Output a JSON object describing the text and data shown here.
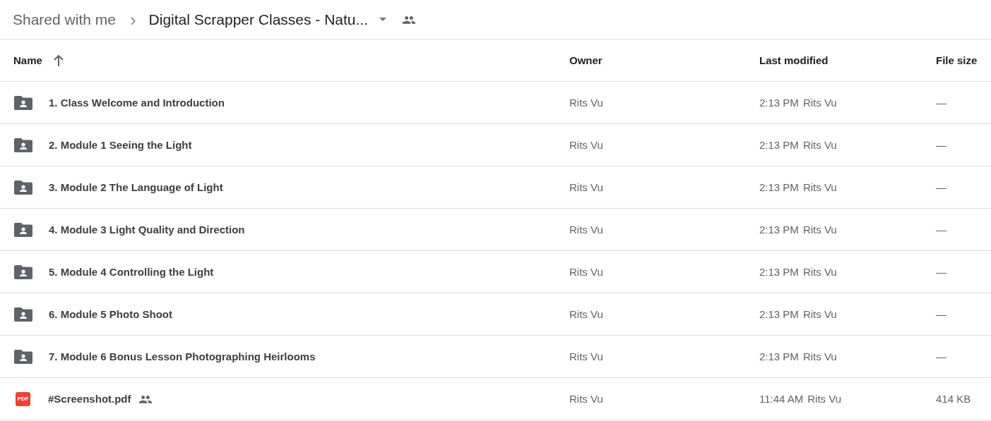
{
  "breadcrumb": {
    "parent": "Shared with me",
    "separator": "›",
    "current": "Digital Scrapper Classes - Natu..."
  },
  "table": {
    "columns": [
      {
        "label": "Name",
        "sorted": true
      },
      {
        "label": "Owner",
        "sorted": false
      },
      {
        "label": "Last modified",
        "sorted": false
      },
      {
        "label": "File size",
        "sorted": false
      }
    ],
    "rows": [
      {
        "kind": "folder",
        "name": "1. Class Welcome and Introduction",
        "shared": false,
        "owner": "Rits Vu",
        "modified_time": "2:13 PM",
        "modified_by": "Rits Vu",
        "size": "—"
      },
      {
        "kind": "folder",
        "name": "2. Module 1 Seeing the Light",
        "shared": false,
        "owner": "Rits Vu",
        "modified_time": "2:13 PM",
        "modified_by": "Rits Vu",
        "size": "—"
      },
      {
        "kind": "folder",
        "name": "3. Module 2 The Language of Light",
        "shared": false,
        "owner": "Rits Vu",
        "modified_time": "2:13 PM",
        "modified_by": "Rits Vu",
        "size": "—"
      },
      {
        "kind": "folder",
        "name": "4. Module 3 Light Quality and Direction",
        "shared": false,
        "owner": "Rits Vu",
        "modified_time": "2:13 PM",
        "modified_by": "Rits Vu",
        "size": "—"
      },
      {
        "kind": "folder",
        "name": "5. Module 4 Controlling the Light",
        "shared": false,
        "owner": "Rits Vu",
        "modified_time": "2:13 PM",
        "modified_by": "Rits Vu",
        "size": "—"
      },
      {
        "kind": "folder",
        "name": "6. Module 5 Photo Shoot",
        "shared": false,
        "owner": "Rits Vu",
        "modified_time": "2:13 PM",
        "modified_by": "Rits Vu",
        "size": "—"
      },
      {
        "kind": "folder",
        "name": "7. Module 6 Bonus Lesson Photographing Heirlooms",
        "shared": false,
        "owner": "Rits Vu",
        "modified_time": "2:13 PM",
        "modified_by": "Rits Vu",
        "size": "—"
      },
      {
        "kind": "pdf",
        "badge": "PDF",
        "name": "#Screenshot.pdf",
        "shared": true,
        "owner": "Rits Vu",
        "modified_time": "11:44 AM",
        "modified_by": "Rits Vu",
        "size": "414 KB"
      }
    ]
  }
}
